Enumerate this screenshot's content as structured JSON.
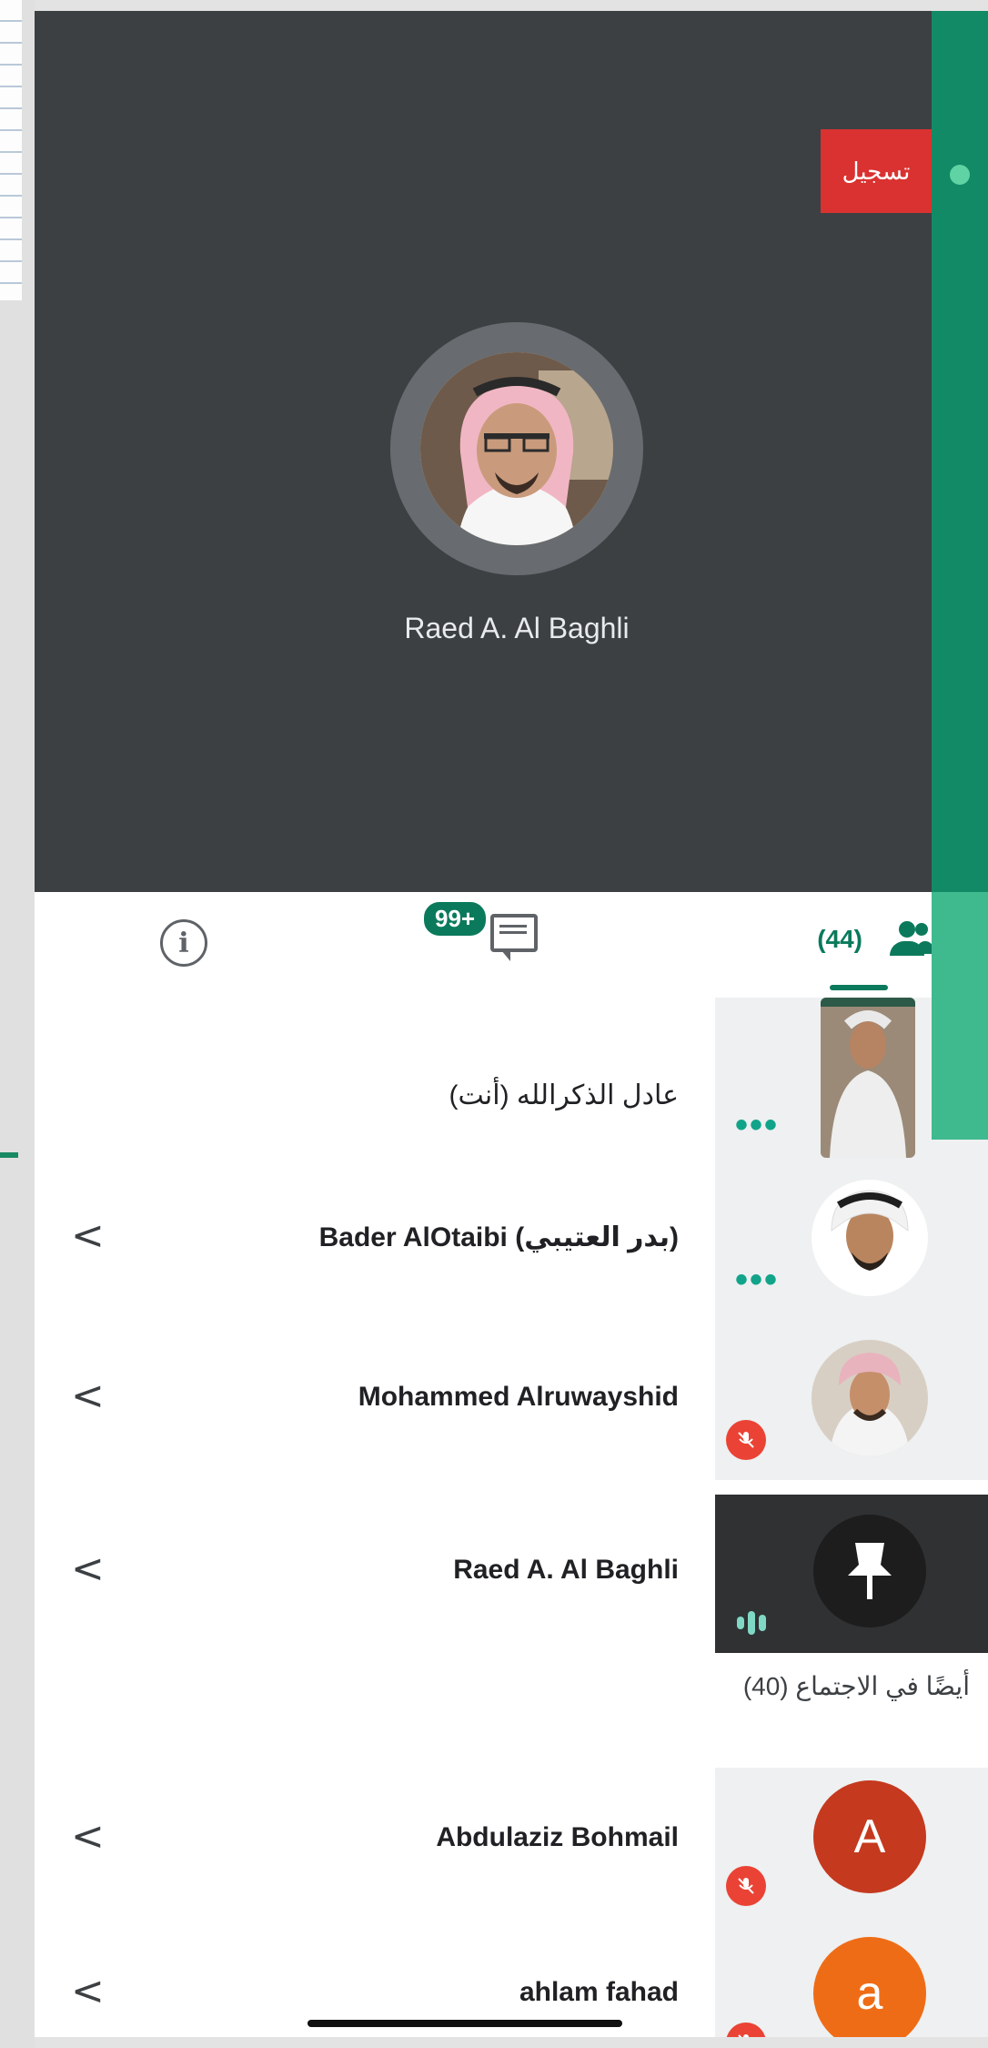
{
  "recording": {
    "label": "تسجيل"
  },
  "stage": {
    "speaker_name": "Raed A. Al Baghli"
  },
  "tabs": {
    "info_icon": "info-icon",
    "chat_badge": "99+",
    "people_count": "(44)"
  },
  "participants": [
    {
      "name": "عادل الذكرالله (أنت)",
      "status": "more",
      "chevron": ""
    },
    {
      "name": "Bader AlOtaibi (بدر العتيبي)",
      "status": "more",
      "chevron": "<"
    },
    {
      "name": "Mohammed Alruwayshid",
      "status": "muted",
      "chevron": "<"
    },
    {
      "name": "Raed A. Al Baghli",
      "status": "speaking",
      "chevron": "<"
    }
  ],
  "also_in_meeting": {
    "title": "أيضًا في الاجتماع (40)",
    "items": [
      {
        "name": "Abdulaziz Bohmail",
        "initial": "A",
        "color": "#c5391e",
        "chevron": "<"
      },
      {
        "name": "ahlam fahad",
        "initial": "a",
        "color": "#ef6c16",
        "chevron": "<"
      }
    ]
  },
  "colors": {
    "accent": "#0b7a5c",
    "rail": "#138a66",
    "stage": "#3c4043",
    "record": "#d93230"
  }
}
